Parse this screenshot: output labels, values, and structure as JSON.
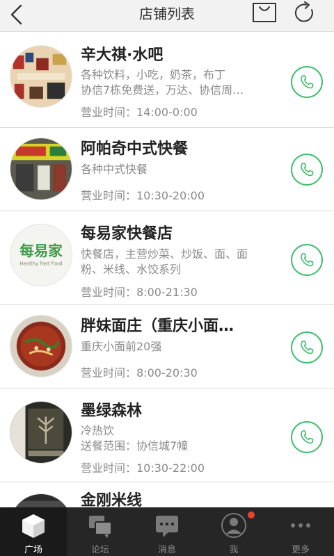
{
  "header": {
    "title": "店铺列表",
    "back_icon": "chevron-left-icon",
    "bag_icon": "shopping-bag-icon",
    "refresh_icon": "refresh-icon"
  },
  "stores": [
    {
      "name": "辛大祺·水吧",
      "desc": [
        "各种饮料，小吃，奶茶，布丁",
        "协信7栋免费送，万达、协信周…"
      ],
      "hours": "营业时间：14:00-0:00"
    },
    {
      "name": "阿帕奇中式快餐",
      "desc": [
        "各种中式快餐"
      ],
      "hours": "营业时间：10:30-20:00"
    },
    {
      "name": "每易家快餐店",
      "desc": [
        "快餐店，主营炒菜、炒饭、面、面",
        "粉、米线、水饺系列"
      ],
      "hours": "营业时间：8:00-21:30",
      "logo_text": "每易家",
      "logo_subtext": "Healthy Fast Food"
    },
    {
      "name": "胖妹面庄（重庆小面…",
      "desc": [
        "重庆小面前20强"
      ],
      "hours": "营业时间：8:00-20:30"
    },
    {
      "name": "墨绿森林",
      "desc": [
        "冷热饮",
        "送餐范围：协信城7幢"
      ],
      "hours": "营业时间：10:30-22:00"
    },
    {
      "name": "金刚米线",
      "desc": [],
      "hours": ""
    }
  ],
  "tabs": [
    {
      "label": "广场",
      "icon": "cube-icon",
      "active": true
    },
    {
      "label": "论坛",
      "icon": "chat-bubbles-icon",
      "active": false
    },
    {
      "label": "消息",
      "icon": "message-icon",
      "active": false
    },
    {
      "label": "我",
      "icon": "avatar-icon",
      "active": false,
      "badge": true
    },
    {
      "label": "更多",
      "icon": "more-dots-icon",
      "active": false
    }
  ],
  "colors": {
    "accent_green": "#3dbf6a",
    "tabbar_bg": "#262626",
    "badge_red": "#e8442f"
  }
}
